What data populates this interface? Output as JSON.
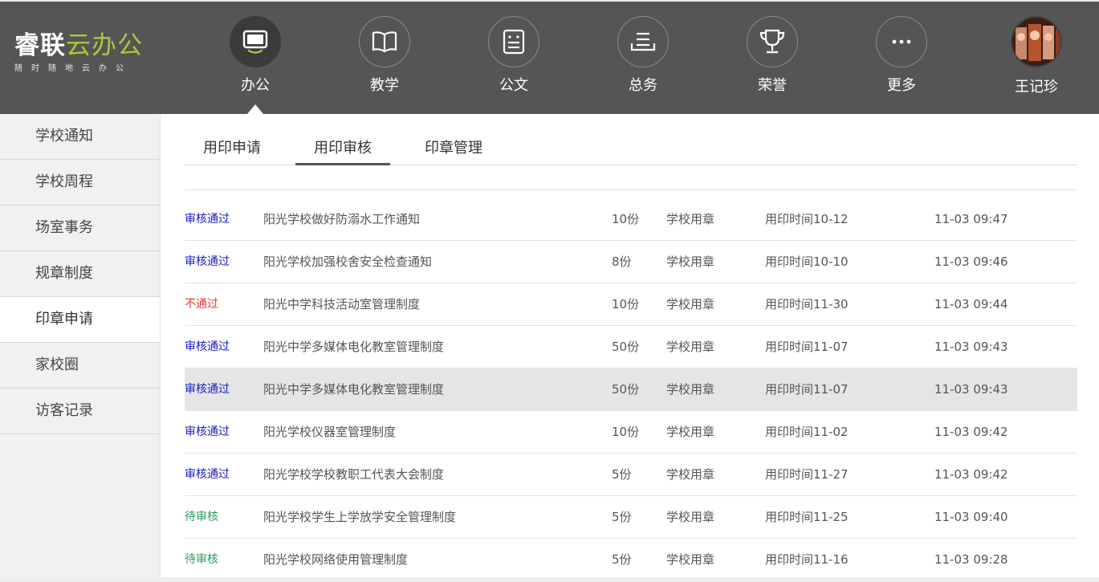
{
  "brand": {
    "name_bold": "睿联",
    "name_light": "云办公",
    "slogan": "随时随地云办公",
    "accent_color": "#a6c93a"
  },
  "nav": [
    {
      "label": "办公",
      "icon": "monitor-icon",
      "active": true
    },
    {
      "label": "教学",
      "icon": "book-icon"
    },
    {
      "label": "公文",
      "icon": "document-icon"
    },
    {
      "label": "总务",
      "icon": "tray-icon"
    },
    {
      "label": "荣誉",
      "icon": "trophy-icon"
    },
    {
      "label": "更多",
      "icon": "more-icon"
    }
  ],
  "user": {
    "name": "王记珍"
  },
  "sidebar": {
    "items": [
      {
        "label": "学校通知"
      },
      {
        "label": "学校周程"
      },
      {
        "label": "场室事务"
      },
      {
        "label": "规章制度"
      },
      {
        "label": "印章申请",
        "active": true
      },
      {
        "label": "家校圈"
      },
      {
        "label": "访客记录"
      }
    ]
  },
  "tabs": [
    {
      "label": "用印申请"
    },
    {
      "label": "用印审核",
      "active": true
    },
    {
      "label": "印章管理"
    }
  ],
  "status_colors": {
    "审核通过": "#1a1acc",
    "不通过": "#e03a3a",
    "待审核": "#2e9a5e"
  },
  "rows": [
    {
      "status": "审核通过",
      "title": "阳光学校做好防溺水工作通知",
      "qty": "10份",
      "seal": "学校用章",
      "use_time": "用印时间10-12",
      "date": "11-03 09:47"
    },
    {
      "status": "审核通过",
      "title": "阳光学校加强校舍安全检查通知",
      "qty": "8份",
      "seal": "学校用章",
      "use_time": "用印时间10-10",
      "date": "11-03 09:46"
    },
    {
      "status": "不通过",
      "title": "阳光中学科技活动室管理制度",
      "qty": "10份",
      "seal": "学校用章",
      "use_time": "用印时间11-30",
      "date": "11-03 09:44"
    },
    {
      "status": "审核通过",
      "title": "阳光中学多媒体电化教室管理制度",
      "qty": "50份",
      "seal": "学校用章",
      "use_time": "用印时间11-07",
      "date": "11-03 09:43"
    },
    {
      "status": "审核通过",
      "title": "阳光中学多媒体电化教室管理制度",
      "qty": "50份",
      "seal": "学校用章",
      "use_time": "用印时间11-07",
      "date": "11-03 09:43",
      "highlighted": true
    },
    {
      "status": "审核通过",
      "title": "阳光学校仪器室管理制度",
      "qty": "10份",
      "seal": "学校用章",
      "use_time": "用印时间11-02",
      "date": "11-03 09:42"
    },
    {
      "status": "审核通过",
      "title": "阳光学校学校教职工代表大会制度",
      "qty": "5份",
      "seal": "学校用章",
      "use_time": "用印时间11-27",
      "date": "11-03 09:42"
    },
    {
      "status": "待审核",
      "title": "阳光学校学生上学放学安全管理制度",
      "qty": "5份",
      "seal": "学校用章",
      "use_time": "用印时间11-25",
      "date": "11-03 09:40"
    },
    {
      "status": "待审核",
      "title": "阳光学校网络使用管理制度",
      "qty": "5份",
      "seal": "学校用章",
      "use_time": "用印时间11-16",
      "date": "11-03 09:28"
    }
  ]
}
